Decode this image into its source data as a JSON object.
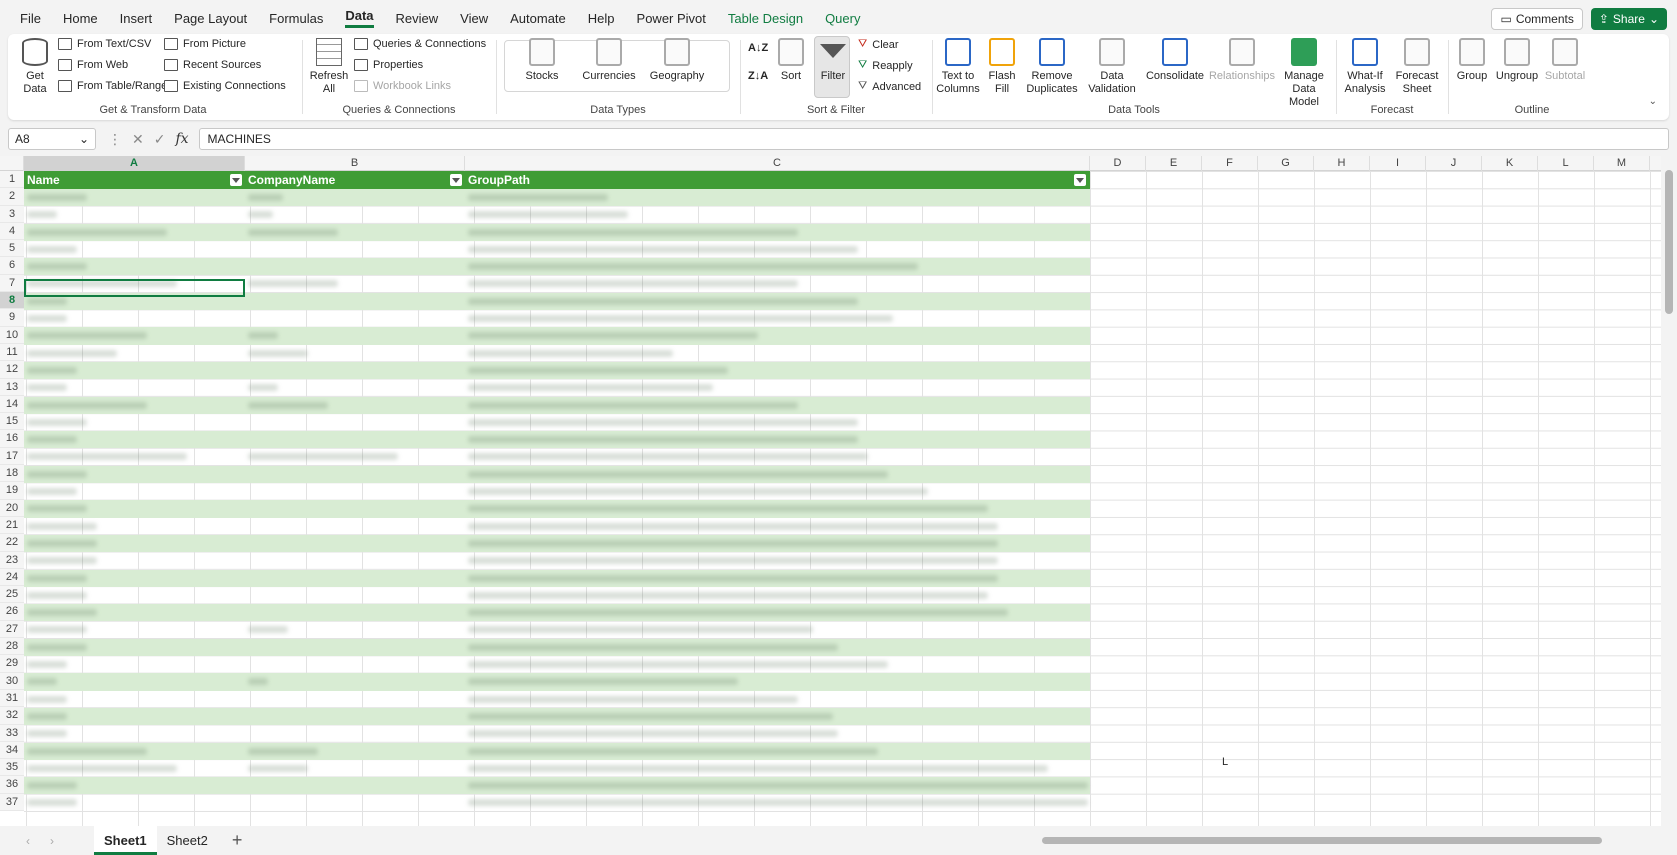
{
  "menu": {
    "items": [
      "File",
      "Home",
      "Insert",
      "Page Layout",
      "Formulas",
      "Data",
      "Review",
      "View",
      "Automate",
      "Help",
      "Power Pivot",
      "Table Design",
      "Query"
    ],
    "comments": "Comments",
    "share": "Share"
  },
  "ribbon": {
    "get_transform": {
      "get_data": "Get Data",
      "from_text_csv": "From Text/CSV",
      "from_web": "From Web",
      "from_table_range": "From Table/Range",
      "from_picture": "From Picture",
      "recent_sources": "Recent Sources",
      "existing_connections": "Existing Connections",
      "label": "Get & Transform Data"
    },
    "queries": {
      "refresh_all": "Refresh All",
      "queries_connections": "Queries & Connections",
      "properties": "Properties",
      "workbook_links": "Workbook Links",
      "label": "Queries & Connections"
    },
    "data_types": {
      "stocks": "Stocks",
      "currencies": "Currencies",
      "geography": "Geography",
      "label": "Data Types"
    },
    "sort_filter": {
      "sort": "Sort",
      "filter": "Filter",
      "clear": "Clear",
      "reapply": "Reapply",
      "advanced": "Advanced",
      "label": "Sort & Filter"
    },
    "data_tools": {
      "text_to_columns": "Text to Columns",
      "flash_fill": "Flash Fill",
      "remove_duplicates": "Remove Duplicates",
      "data_validation": "Data Validation",
      "consolidate": "Consolidate",
      "relationships": "Relationships",
      "manage_data_model": "Manage Data Model",
      "label": "Data Tools"
    },
    "forecast": {
      "what_if": "What-If Analysis",
      "forecast_sheet": "Forecast Sheet",
      "label": "Forecast"
    },
    "outline": {
      "group": "Group",
      "ungroup": "Ungroup",
      "subtotal": "Subtotal",
      "label": "Outline"
    }
  },
  "formula_bar": {
    "name_box": "A8",
    "fx": "fx",
    "value": "MACHINES"
  },
  "sheet": {
    "columns": [
      "A",
      "B",
      "C",
      "D",
      "E",
      "F",
      "G",
      "H",
      "I",
      "J",
      "K",
      "L",
      "M"
    ],
    "rows": [
      "1",
      "2",
      "3",
      "4",
      "5",
      "6",
      "7",
      "8",
      "9",
      "10",
      "11",
      "12",
      "13",
      "14",
      "15",
      "16",
      "17",
      "18",
      "19",
      "20",
      "21",
      "22",
      "23",
      "24",
      "25",
      "26",
      "27",
      "28",
      "29",
      "30",
      "31",
      "32",
      "33",
      "34",
      "35",
      "36",
      "37"
    ],
    "table_headers": [
      "Name",
      "CompanyName",
      "GroupPath"
    ],
    "stray_text": "L"
  },
  "tabs": {
    "sheet1": "Sheet1",
    "sheet2": "Sheet2",
    "add": "+"
  },
  "colors": {
    "accent": "#107c41",
    "table_header": "#3f9c35",
    "table_band": "#d8ecd3"
  }
}
